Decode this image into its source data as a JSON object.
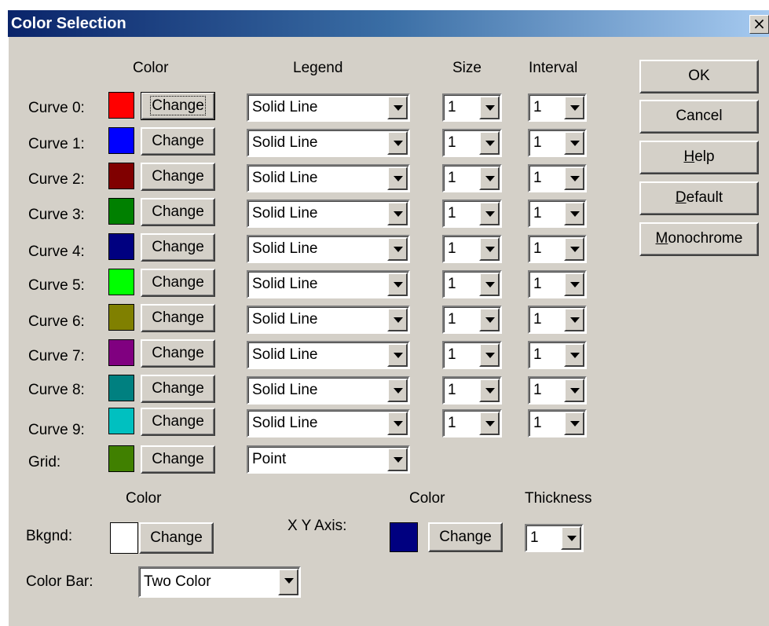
{
  "window": {
    "title": "Color Selection",
    "close_glyph": "×"
  },
  "headers": {
    "color": "Color",
    "legend": "Legend",
    "size": "Size",
    "interval": "Interval"
  },
  "change_label": "Change",
  "curves": [
    {
      "label": "Curve 0:",
      "color": "#ff0000",
      "legend": "Solid Line",
      "size": "1",
      "interval": "1"
    },
    {
      "label": "Curve 1:",
      "color": "#0000ff",
      "legend": "Solid Line",
      "size": "1",
      "interval": "1"
    },
    {
      "label": "Curve 2:",
      "color": "#800000",
      "legend": "Solid Line",
      "size": "1",
      "interval": "1"
    },
    {
      "label": "Curve 3:",
      "color": "#008000",
      "legend": "Solid Line",
      "size": "1",
      "interval": "1"
    },
    {
      "label": "Curve 4:",
      "color": "#000080",
      "legend": "Solid Line",
      "size": "1",
      "interval": "1"
    },
    {
      "label": "Curve 5:",
      "color": "#00ff00",
      "legend": "Solid Line",
      "size": "1",
      "interval": "1"
    },
    {
      "label": "Curve 6:",
      "color": "#808000",
      "legend": "Solid Line",
      "size": "1",
      "interval": "1"
    },
    {
      "label": "Curve 7:",
      "color": "#800080",
      "legend": "Solid Line",
      "size": "1",
      "interval": "1"
    },
    {
      "label": "Curve 8:",
      "color": "#008080",
      "legend": "Solid Line",
      "size": "1",
      "interval": "1"
    },
    {
      "label": "Curve 9:",
      "color": "#00c0c0",
      "legend": "Solid Line",
      "size": "1",
      "interval": "1"
    }
  ],
  "grid": {
    "label": "Grid:",
    "color": "#408000",
    "legend": "Point"
  },
  "bottom": {
    "color_header_left": "Color",
    "color_header_right": "Color",
    "thickness_header": "Thickness",
    "bkgnd_label": "Bkgnd:",
    "bkgnd_color": "#ffffff",
    "xy_axis_label": "X Y Axis:",
    "xy_axis_color": "#000080",
    "thickness_value": "1",
    "color_bar_label": "Color Bar:",
    "color_bar_value": "Two Color"
  },
  "actions": {
    "ok": "OK",
    "cancel": "Cancel",
    "help_u": "H",
    "help_rest": "elp",
    "default_u": "D",
    "default_rest": "efault",
    "mono_u": "M",
    "mono_rest": "onochrome"
  }
}
